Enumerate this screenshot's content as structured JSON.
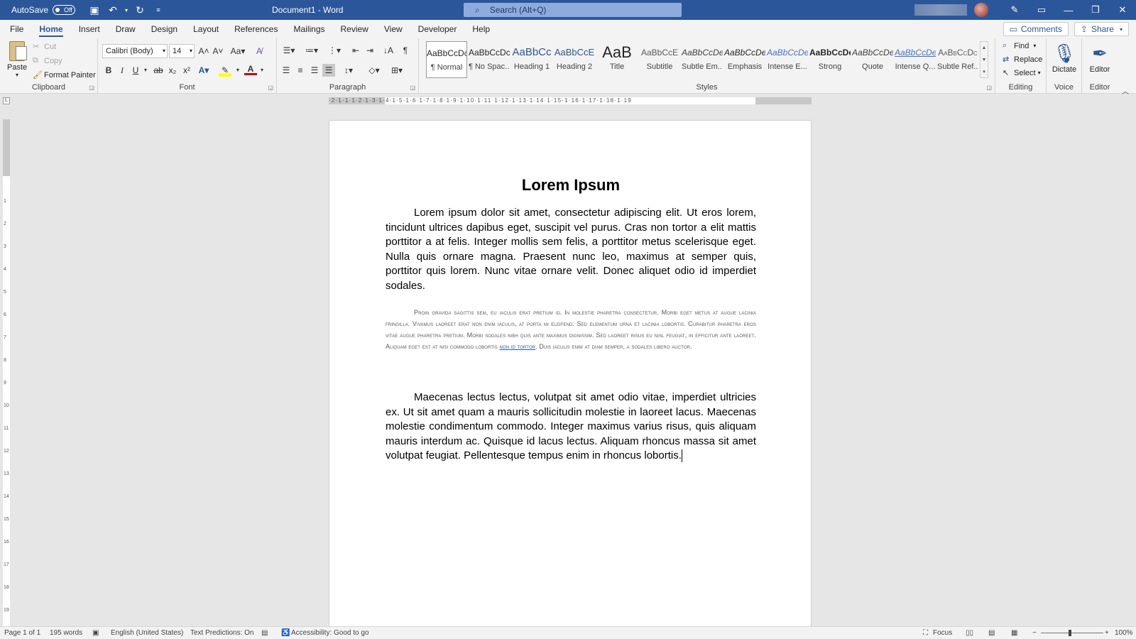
{
  "titlebar": {
    "autosave_label": "AutoSave",
    "autosave_state": "Off",
    "doc_title": "Document1  -  Word",
    "search_placeholder": "Search (Alt+Q)"
  },
  "menu": {
    "tabs": [
      "File",
      "Home",
      "Insert",
      "Draw",
      "Design",
      "Layout",
      "References",
      "Mailings",
      "Review",
      "View",
      "Developer",
      "Help"
    ],
    "active": "Home",
    "comments_label": "Comments",
    "share_label": "Share"
  },
  "ribbon": {
    "clipboard": {
      "paste": "Paste",
      "cut": "Cut",
      "copy": "Copy",
      "format_painter": "Format Painter",
      "label": "Clipboard"
    },
    "font": {
      "name": "Calibri (Body)",
      "size": "14",
      "label": "Font"
    },
    "paragraph": {
      "label": "Paragraph"
    },
    "styles": {
      "label": "Styles",
      "items": [
        {
          "sample": "AaBbCcDc",
          "name": "¶ Normal"
        },
        {
          "sample": "AaBbCcDc",
          "name": "¶ No Spac..."
        },
        {
          "sample": "AaBbCc",
          "name": "Heading 1"
        },
        {
          "sample": "AaBbCcE",
          "name": "Heading 2"
        },
        {
          "sample": "AaB",
          "name": "Title"
        },
        {
          "sample": "AaBbCcE",
          "name": "Subtitle"
        },
        {
          "sample": "AaBbCcDe",
          "name": "Subtle Em..."
        },
        {
          "sample": "AaBbCcDe",
          "name": "Emphasis"
        },
        {
          "sample": "AaBbCcDe",
          "name": "Intense E..."
        },
        {
          "sample": "AaBbCcDe",
          "name": "Strong"
        },
        {
          "sample": "AaBbCcDe",
          "name": "Quote"
        },
        {
          "sample": "AaBbCcDe",
          "name": "Intense Q..."
        },
        {
          "sample": "AaBbCcDc",
          "name": "Subtle Ref..."
        }
      ]
    },
    "editing": {
      "find": "Find",
      "replace": "Replace",
      "select": "Select",
      "label": "Editing"
    },
    "voice": {
      "dictate": "Dictate",
      "label": "Voice"
    },
    "editor": {
      "editor": "Editor",
      "label": "Editor"
    }
  },
  "ruler": {
    "h_text": "·2·1·1·1·2·1·3·1·4·1·5·1·6·1·7·1·8·1·9·1·10·1·11·1·12·1·13·1·14·1·15·1·16·1·17·1·18·1·19"
  },
  "document": {
    "title": "Lorem Ipsum",
    "p1": "Lorem ipsum dolor sit amet, consectetur adipiscing elit. Ut eros lorem, tincidunt ultrices dapibus eget, suscipit vel purus. Cras non tortor a elit mattis porttitor a at felis. Integer mollis sem felis, a porttitor metus scelerisque eget. Nulla quis ornare magna. Praesent nunc leo, maximus at semper quis, porttitor quis lorem. Nunc vitae ornare velit. Donec aliquet odio id imperdiet sodales.",
    "p2_before": "Proin gravida sagittis sem, eu iaculis erat pretium id. In molestie pharetra consectetur. Morbi eget metus at augue lacinia fringilla. Vivamus laoreet erat non enim iaculis, at porta mi eleifend. Sed elementum urna et lacinia lobortis. Curabitur pharetra eros vitae augue pharetra pretium. Morbi sodales nibh quis ante maximus dignissim. Sed laoreet risus eu nisl feugiat, in efficitur ante laoreet. Aliquam eget est at nisi commodo lobortis ",
    "p2_link": "non id tortor",
    "p2_after": ". Duis iaculis enim at diam semper, a sodales libero auctor.",
    "p3": "Maecenas lectus lectus, volutpat sit amet odio vitae, imperdiet ultricies ex. Ut sit amet quam a mauris sollicitudin molestie in laoreet lacus. Maecenas molestie condimentum commodo. Integer maximus varius risus, quis aliquam mauris interdum ac. Quisque id lacus lectus. Aliquam rhoncus massa sit amet volutpat feugiat. Pellentesque tempus enim in rhoncus lobortis."
  },
  "status": {
    "page": "Page 1 of 1",
    "words": "195 words",
    "language": "English (United States)",
    "predictions": "Text Predictions: On",
    "accessibility": "Accessibility: Good to go",
    "focus": "Focus",
    "zoom": "100%"
  }
}
